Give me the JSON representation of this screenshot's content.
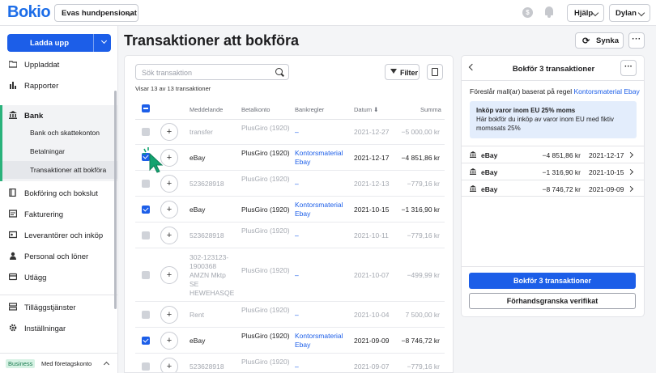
{
  "topbar": {
    "logo": "Bokio",
    "company": "Evas hundpensionat",
    "coin_glyph": "$",
    "help": "Hjälp",
    "user": "Dylan"
  },
  "sidebar": {
    "upload_label": "Ladda upp",
    "items": [
      {
        "label": "Uppladdat",
        "icon": "folder-icon"
      },
      {
        "label": "Rapporter",
        "icon": "bar-chart-icon"
      },
      {
        "label": "Bank",
        "icon": "bank-icon"
      },
      {
        "label": "Bokföring och bokslut",
        "icon": "book-icon"
      },
      {
        "label": "Fakturering",
        "icon": "invoice-icon"
      },
      {
        "label": "Leverantörer och inköp",
        "icon": "supplier-icon"
      },
      {
        "label": "Personal och löner",
        "icon": "person-icon"
      },
      {
        "label": "Utlägg",
        "icon": "receipt-icon"
      },
      {
        "label": "Tilläggstjänster",
        "icon": "addon-icon"
      },
      {
        "label": "Inställningar",
        "icon": "gear-icon"
      }
    ],
    "bank_sub": [
      "Bank och skattekonton",
      "Betalningar",
      "Transaktioner att bokföra"
    ],
    "plan_badge": "Business",
    "plan_text": "Med företagskonto"
  },
  "main": {
    "title": "Transaktioner att bokföra",
    "sync_label": "Synka",
    "more_label": "···",
    "search_placeholder": "Sök transaktion",
    "filter_label": "Filter",
    "showing": "Visar 13 av 13 transaktioner",
    "columns": {
      "desc": "Meddelande",
      "account": "Betalkonto",
      "rule": "Bankregler",
      "date": "Datum ⬇",
      "amount": "Summa"
    },
    "rows": [
      {
        "checked": false,
        "desc": "transfer",
        "account": "PlusGiro (1920)",
        "rule": "–",
        "date": "2021-12-27",
        "amount": "−5 000,00 kr"
      },
      {
        "checked": true,
        "desc": "eBay",
        "account": "PlusGiro (1920)",
        "rule": "Kontorsmaterial Ebay",
        "date": "2021-12-17",
        "amount": "−4 851,86 kr"
      },
      {
        "checked": false,
        "desc": "523628918",
        "account": "PlusGiro (1920)",
        "rule": "–",
        "date": "2021-12-13",
        "amount": "−779,16 kr"
      },
      {
        "checked": true,
        "desc": "eBay",
        "account": "PlusGiro (1920)",
        "rule": "Kontorsmaterial Ebay",
        "date": "2021-10-15",
        "amount": "−1 316,90 kr"
      },
      {
        "checked": false,
        "desc": "523628918",
        "account": "PlusGiro (1920)",
        "rule": "–",
        "date": "2021-10-11",
        "amount": "−779,16 kr"
      },
      {
        "checked": false,
        "desc": "302-123123-1900368 AMZN Mktp SE HEWEHASQE",
        "account": "PlusGiro (1920)",
        "rule": "–",
        "date": "2021-10-07",
        "amount": "−499,99 kr"
      },
      {
        "checked": false,
        "desc": "Rent",
        "account": "PlusGiro (1920)",
        "rule": "–",
        "date": "2021-10-04",
        "amount": "7 500,00 kr"
      },
      {
        "checked": true,
        "desc": "eBay",
        "account": "PlusGiro (1920)",
        "rule": "Kontorsmaterial Ebay",
        "date": "2021-09-09",
        "amount": "−8 746,72 kr"
      },
      {
        "checked": false,
        "desc": "523628918",
        "account": "PlusGiro (1920)",
        "rule": "–",
        "date": "2021-09-07",
        "amount": "−779,16 kr"
      }
    ]
  },
  "book_panel": {
    "title": "Bokför 3 transaktioner",
    "suggest_prefix": "Föreslår mall(ar) baserat på regel ",
    "suggest_link": "Kontorsmaterial Ebay",
    "note_title": "Inköp varor inom EU 25% moms",
    "note_text": "Här bokför du inköp av varor inom EU med fiktiv momssats 25%",
    "items": [
      {
        "name": "eBay",
        "amount": "−4 851,86 kr",
        "date": "2021-12-17"
      },
      {
        "name": "eBay",
        "amount": "−1 316,90 kr",
        "date": "2021-10-15"
      },
      {
        "name": "eBay",
        "amount": "−8 746,72 kr",
        "date": "2021-09-09"
      }
    ],
    "primary_label": "Bokför 3 transaktioner",
    "secondary_label": "Förhandsgranska verifikat"
  },
  "colors": {
    "accent": "#1c5ee8",
    "brand_green": "#2ab27b"
  }
}
